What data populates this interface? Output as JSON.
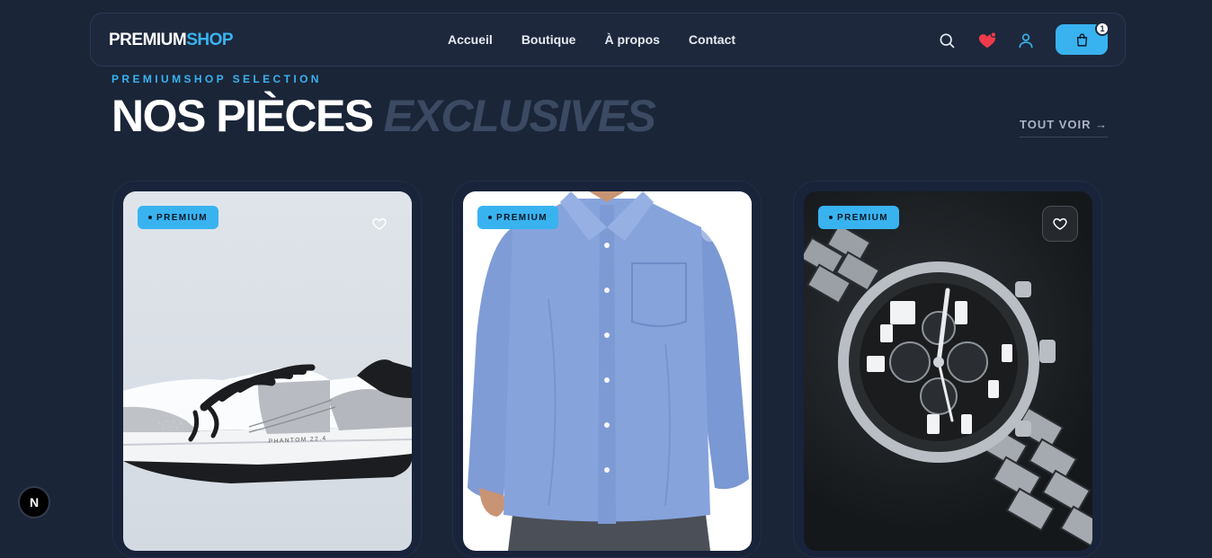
{
  "header": {
    "logo_part1": "PREMIUM",
    "logo_part2": "SHOP",
    "nav": [
      "Accueil",
      "Boutique",
      "À propos",
      "Contact"
    ],
    "cart_count": "1",
    "icons": [
      "search-icon",
      "heart-icon",
      "user-icon",
      "shopping-bag-icon"
    ]
  },
  "section": {
    "eyebrow": "PREMIUMSHOP SELECTION",
    "title_main": "NOS PIÈCES",
    "title_accent": "EXCLUSIVES",
    "see_all": "TOUT VOIR →"
  },
  "products": [
    {
      "badge": "PREMIUM",
      "image": "sneaker",
      "print": "PHANTOM 22.4"
    },
    {
      "badge": "PREMIUM",
      "image": "blue-shirt"
    },
    {
      "badge": "PREMIUM",
      "image": "chronograph-watch"
    }
  ],
  "dev_badge": "N",
  "colors": {
    "background": "#1b2538",
    "accent": "#38b3f0",
    "heart": "#ef3b4a",
    "muted_title": "#3b4a62"
  }
}
